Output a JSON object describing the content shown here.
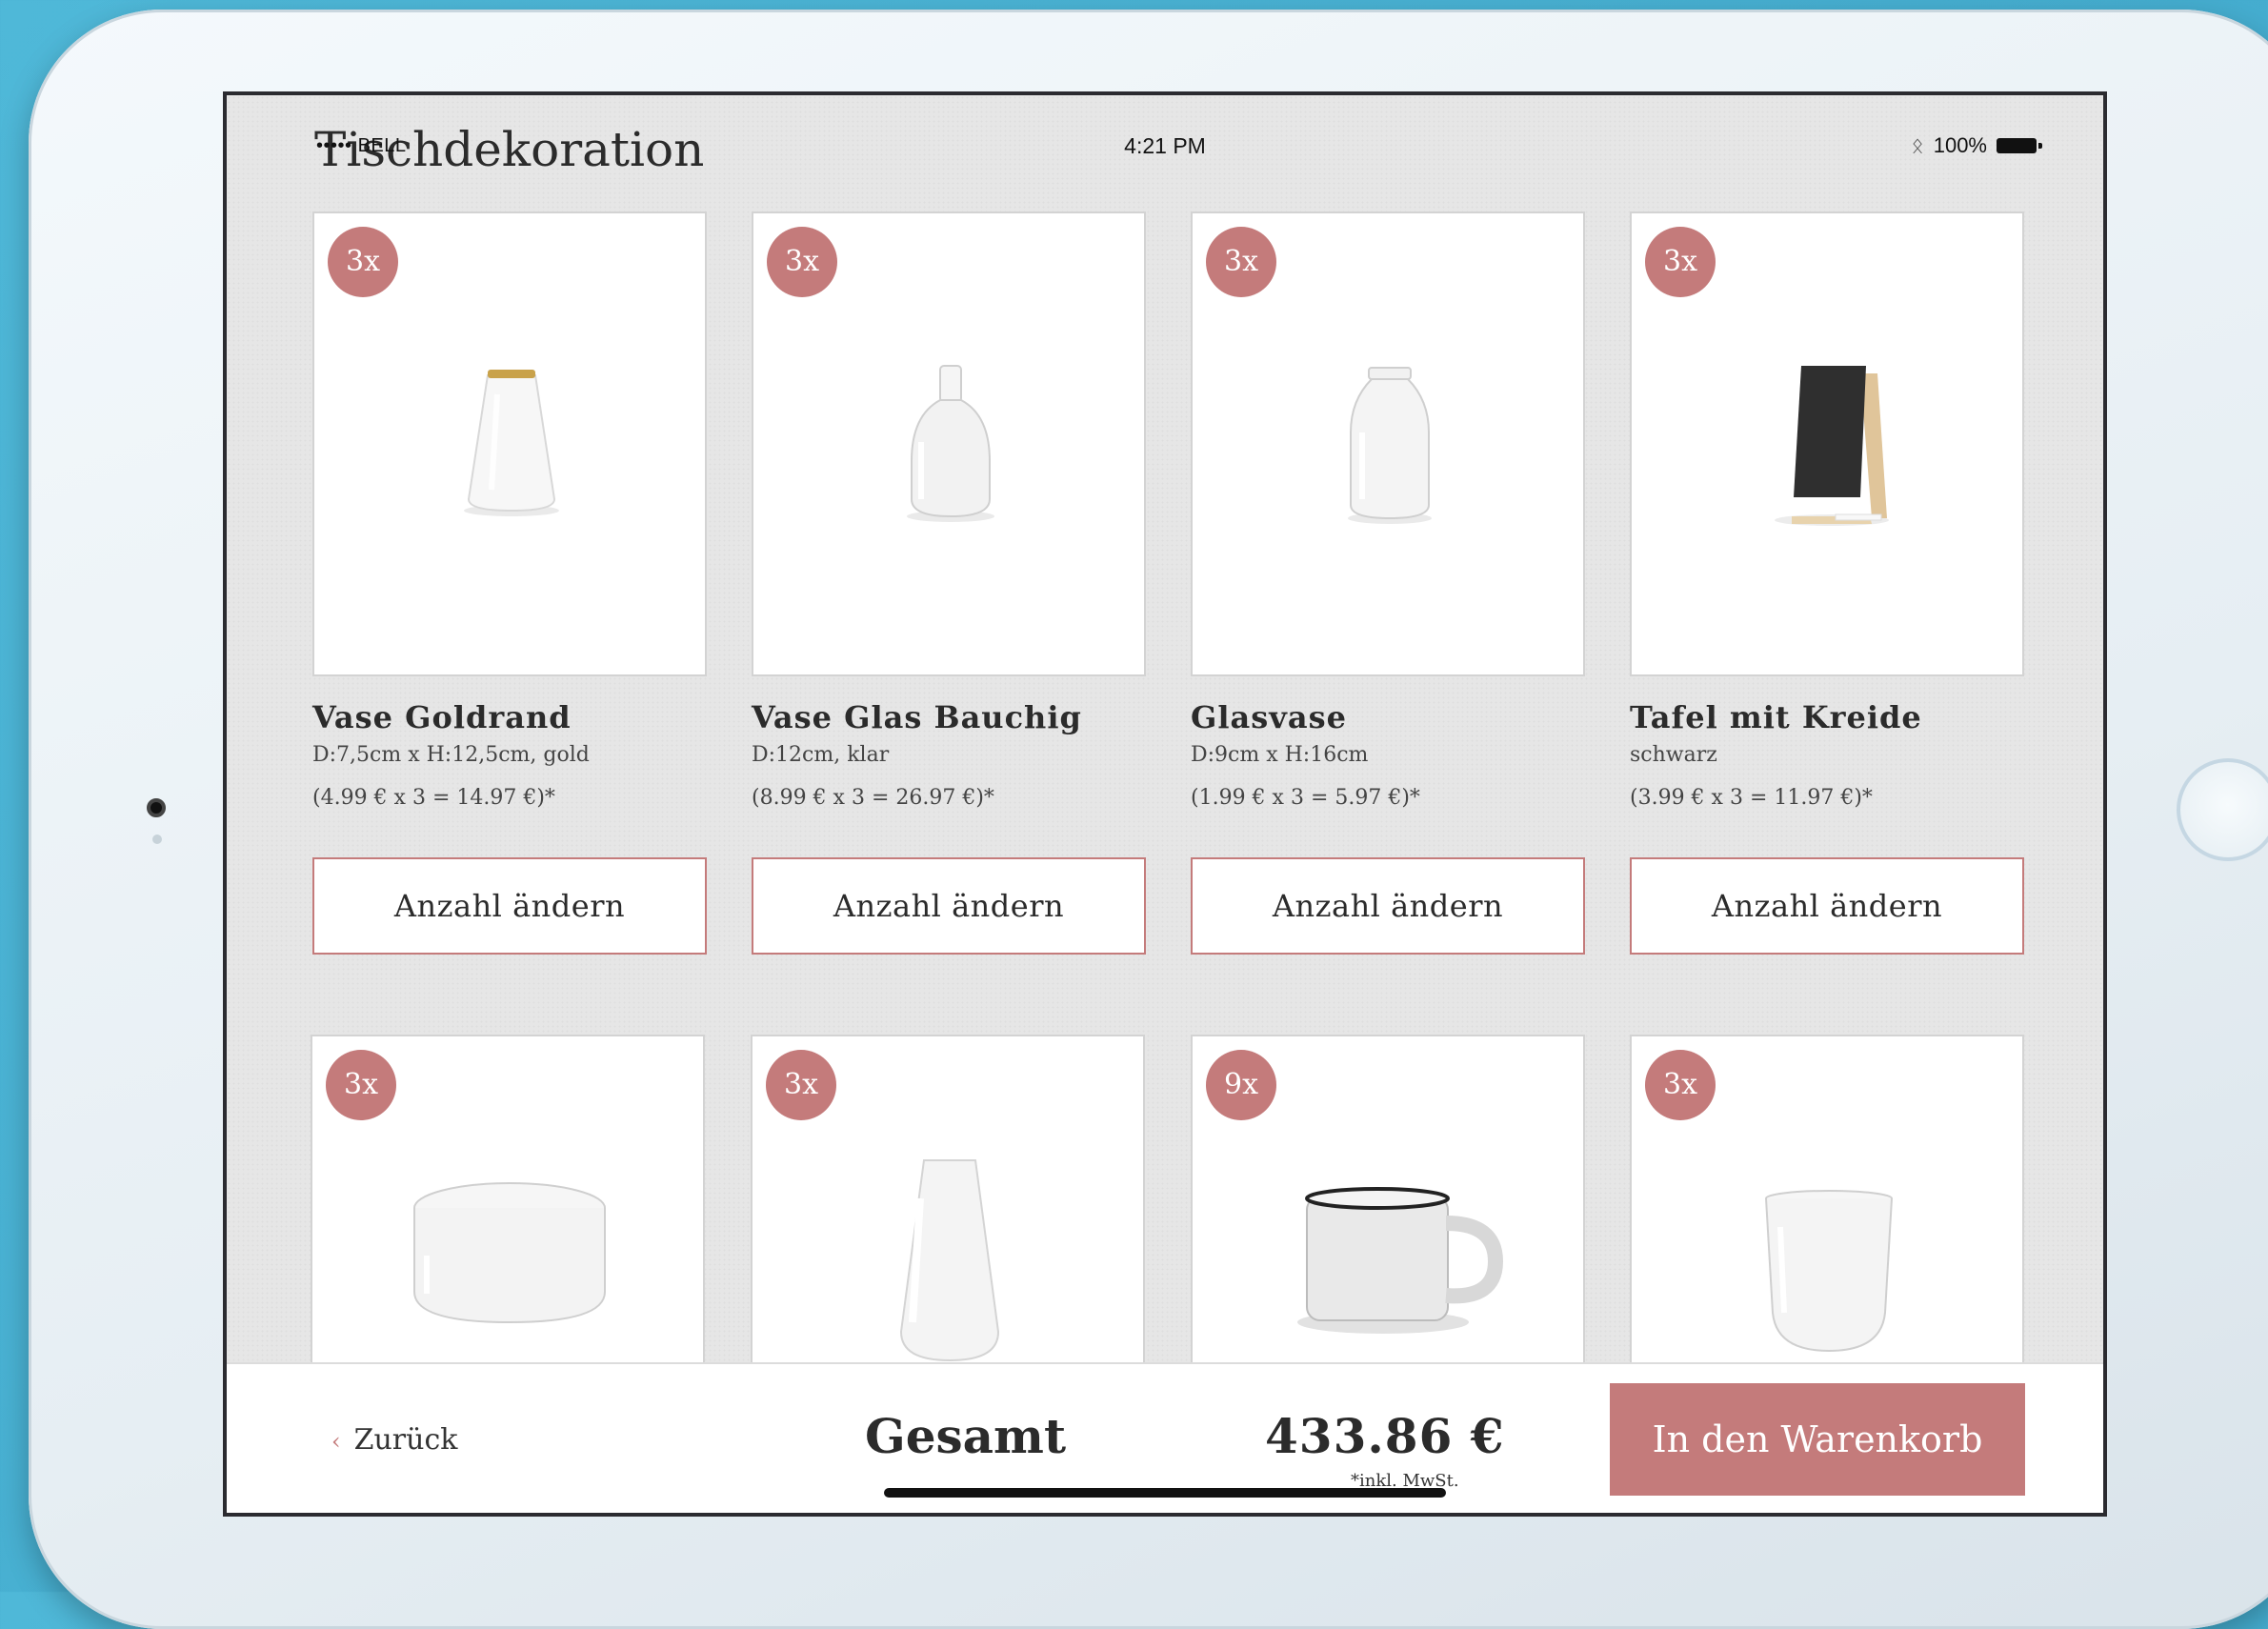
{
  "status_bar": {
    "carrier": "••••• BELL",
    "time": "4:21 PM",
    "bluetooth": "bluetooth-icon",
    "battery": "100%"
  },
  "page": {
    "title": "Tischdekoration"
  },
  "products": [
    {
      "badge": "3x",
      "name": "Vase Goldrand",
      "desc": "D:7,5cm x H:12,5cm, gold",
      "price": "(4.99 € x 3 = 14.97 €)*",
      "button": "Anzahl ändern"
    },
    {
      "badge": "3x",
      "name": "Vase Glas Bauchig",
      "desc": "D:12cm, klar",
      "price": "(8.99 € x 3 = 26.97 €)*",
      "button": "Anzahl ändern"
    },
    {
      "badge": "3x",
      "name": "Glasvase",
      "desc": "D:9cm x H:16cm",
      "price": "(1.99 € x 3 = 5.97 €)*",
      "button": "Anzahl ändern"
    },
    {
      "badge": "3x",
      "name": "Tafel mit Kreide",
      "desc": "schwarz",
      "price": "(3.99 € x 3 = 11.97 €)*",
      "button": "Anzahl ändern"
    },
    {
      "badge": "3x"
    },
    {
      "badge": "3x"
    },
    {
      "badge": "9x"
    },
    {
      "badge": "3x"
    }
  ],
  "bottom": {
    "back_label": "Zurück",
    "total_label": "Gesamt",
    "total_amount": "433.86 €",
    "vat_note": "*inkl. MwSt.",
    "cart_button": "In den Warenkorb"
  },
  "colors": {
    "accent": "#c47b7b",
    "background": "#e6e6e6"
  }
}
